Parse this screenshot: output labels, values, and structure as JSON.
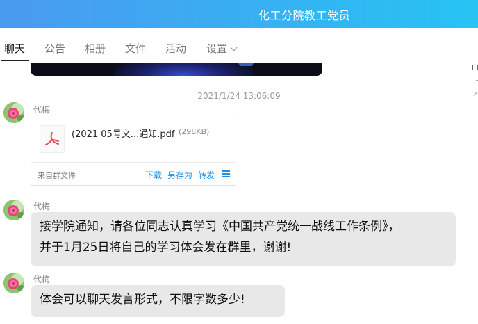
{
  "window": {
    "title": "化工分院教工党员"
  },
  "tabs": [
    {
      "label": "聊天",
      "active": true
    },
    {
      "label": "公告"
    },
    {
      "label": "相册"
    },
    {
      "label": "文件"
    },
    {
      "label": "活动"
    },
    {
      "label": "设置"
    }
  ],
  "chat": {
    "timestamp": "2021/1/24 13:06:09",
    "messages": [
      {
        "sender": "代梅",
        "type": "file",
        "file": {
          "name": "(2021  05号文...通知.pdf",
          "size": "(298KB)",
          "source": "来自群文件",
          "actions": {
            "download": "下载",
            "save_as": "另存为",
            "forward": "转发"
          }
        }
      },
      {
        "sender": "代梅",
        "type": "text",
        "lines": [
          "接学院通知，请各位同志认真学习《中国共产党统一战线工作条例》，",
          "并于1月25日将自己的学习体会发在群里，谢谢!"
        ]
      },
      {
        "sender": "代梅",
        "type": "text",
        "lines": [
          "体会可以聊天发言形式，不限字数多少!"
        ]
      }
    ]
  },
  "colors": {
    "titlebar_start": "#4a9af0",
    "titlebar_end": "#27c3f3",
    "link": "#1f8fe0",
    "bubble": "#e8e8e8"
  }
}
